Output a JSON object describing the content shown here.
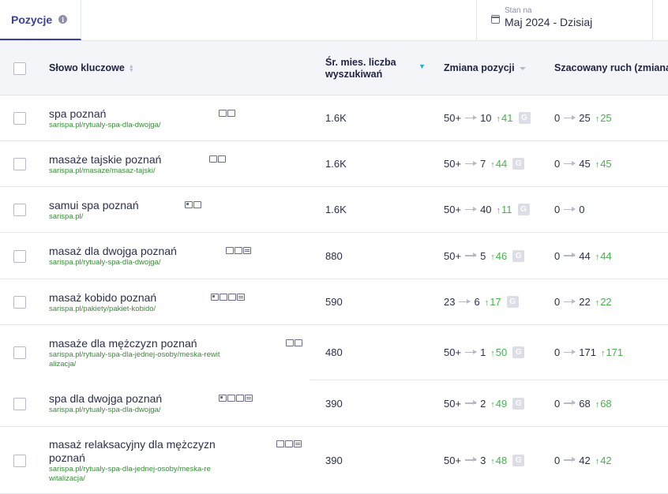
{
  "tabs": {
    "active_label": "Pozycje"
  },
  "date": {
    "label": "Stan na",
    "value": "Maj 2024 - Dzisiaj"
  },
  "columns": {
    "keyword": "Słowo kluczowe",
    "volume_line1": "Śr. mies. liczba",
    "volume_line2": "wyszukiwań",
    "position_change": "Zmiana pozycji",
    "traffic": "Szacowany ruch (zmiana)"
  },
  "rows": [
    {
      "keyword": "spa poznań",
      "keyword2": "",
      "url": "sarispa.pl/rytualy-spa-dla-dwojga/",
      "url2": "",
      "volume": "1.6K",
      "pos_from": "50+",
      "pos_to": "10",
      "pos_up": "41",
      "traffic_from": "0",
      "traffic_to": "25",
      "traffic_up": "25",
      "serp": [
        "map",
        "bubble"
      ]
    },
    {
      "keyword": "masaże tajskie poznań",
      "keyword2": "",
      "url": "sarispa.pl/masaze/masaz-tajski/",
      "url2": "",
      "volume": "1.6K",
      "pos_from": "50+",
      "pos_to": "7",
      "pos_up": "44",
      "traffic_from": "0",
      "traffic_to": "45",
      "traffic_up": "45",
      "serp": [
        "map",
        "bubble"
      ]
    },
    {
      "keyword": "samui spa poznań",
      "keyword2": "",
      "url": "sarispa.pl/",
      "url2": "",
      "volume": "1.6K",
      "pos_from": "50+",
      "pos_to": "40",
      "pos_up": "11",
      "traffic_from": "0",
      "traffic_to": "0",
      "traffic_up": "",
      "serp": [
        "img",
        "bubble"
      ]
    },
    {
      "keyword": "masaż dla dwojga poznań",
      "keyword2": "",
      "url": "sarispa.pl/rytualy-spa-dla-dwojga/",
      "url2": "",
      "volume": "880",
      "pos_from": "50+",
      "pos_to": "5",
      "pos_up": "46",
      "traffic_from": "0",
      "traffic_to": "44",
      "traffic_up": "44",
      "serp": [
        "map",
        "bubble",
        "list"
      ]
    },
    {
      "keyword": "masaż kobido poznań",
      "keyword2": "",
      "url": "sarispa.pl/pakiety/pakiet-kobido/",
      "url2": "",
      "volume": "590",
      "pos_from": "23",
      "pos_to": "6",
      "pos_up": "17",
      "traffic_from": "0",
      "traffic_to": "22",
      "traffic_up": "22",
      "serp": [
        "img",
        "map",
        "bubble",
        "list"
      ]
    },
    {
      "keyword": "masaże dla mężczyzn poznań",
      "keyword2": "",
      "url": "sarispa.pl/rytualy-spa-dla-jednej-osoby/meska-rewit",
      "url2": "alizacja/",
      "volume": "480",
      "pos_from": "50+",
      "pos_to": "1",
      "pos_up": "50",
      "traffic_from": "0",
      "traffic_to": "171",
      "traffic_up": "171",
      "serp": [
        "map",
        "bubble"
      ]
    },
    {
      "keyword": "spa dla dwojga poznań",
      "keyword2": "",
      "url": "sarispa.pl/rytualy-spa-dla-dwojga/",
      "url2": "",
      "volume": "390",
      "pos_from": "50+",
      "pos_to": "2",
      "pos_up": "49",
      "traffic_from": "0",
      "traffic_to": "68",
      "traffic_up": "68",
      "serp": [
        "img",
        "map",
        "bubble",
        "list"
      ]
    },
    {
      "keyword": "masaż relaksacyjny dla mężczyzn",
      "keyword2": "poznań",
      "url": "sarispa.pl/rytualy-spa-dla-jednej-osoby/meska-re",
      "url2": "witalizacja/",
      "volume": "390",
      "pos_from": "50+",
      "pos_to": "3",
      "pos_up": "48",
      "traffic_from": "0",
      "traffic_to": "42",
      "traffic_up": "42",
      "serp": [
        "map",
        "bubble",
        "list"
      ]
    }
  ],
  "google_badge": "G"
}
